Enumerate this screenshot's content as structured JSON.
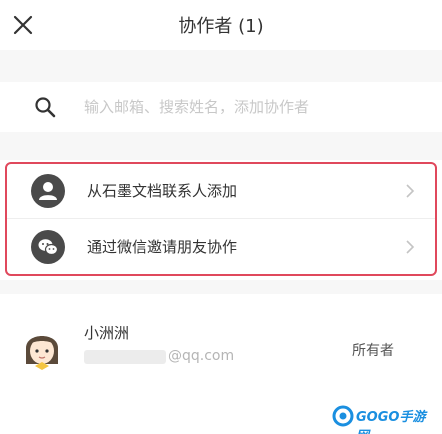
{
  "header": {
    "title": "协作者 (1)",
    "close_icon": "close-icon"
  },
  "search": {
    "placeholder": "输入邮箱、搜索姓名，添加协作者",
    "value": ""
  },
  "options": [
    {
      "label": "从石墨文档联系人添加",
      "icon": "contact-person-icon"
    },
    {
      "label": "通过微信邀请朋友协作",
      "icon": "wechat-icon"
    }
  ],
  "members": [
    {
      "name": "小洲洲",
      "email_suffix": "@qq.com",
      "role": "所有者"
    }
  ],
  "colors": {
    "highlight_border": "#e0485c",
    "background_band": "#f7f7f7",
    "icon_fill": "#4a4a4a",
    "watermark": "#1a8fe0"
  },
  "watermark": {
    "text": "GOGO手游网"
  }
}
